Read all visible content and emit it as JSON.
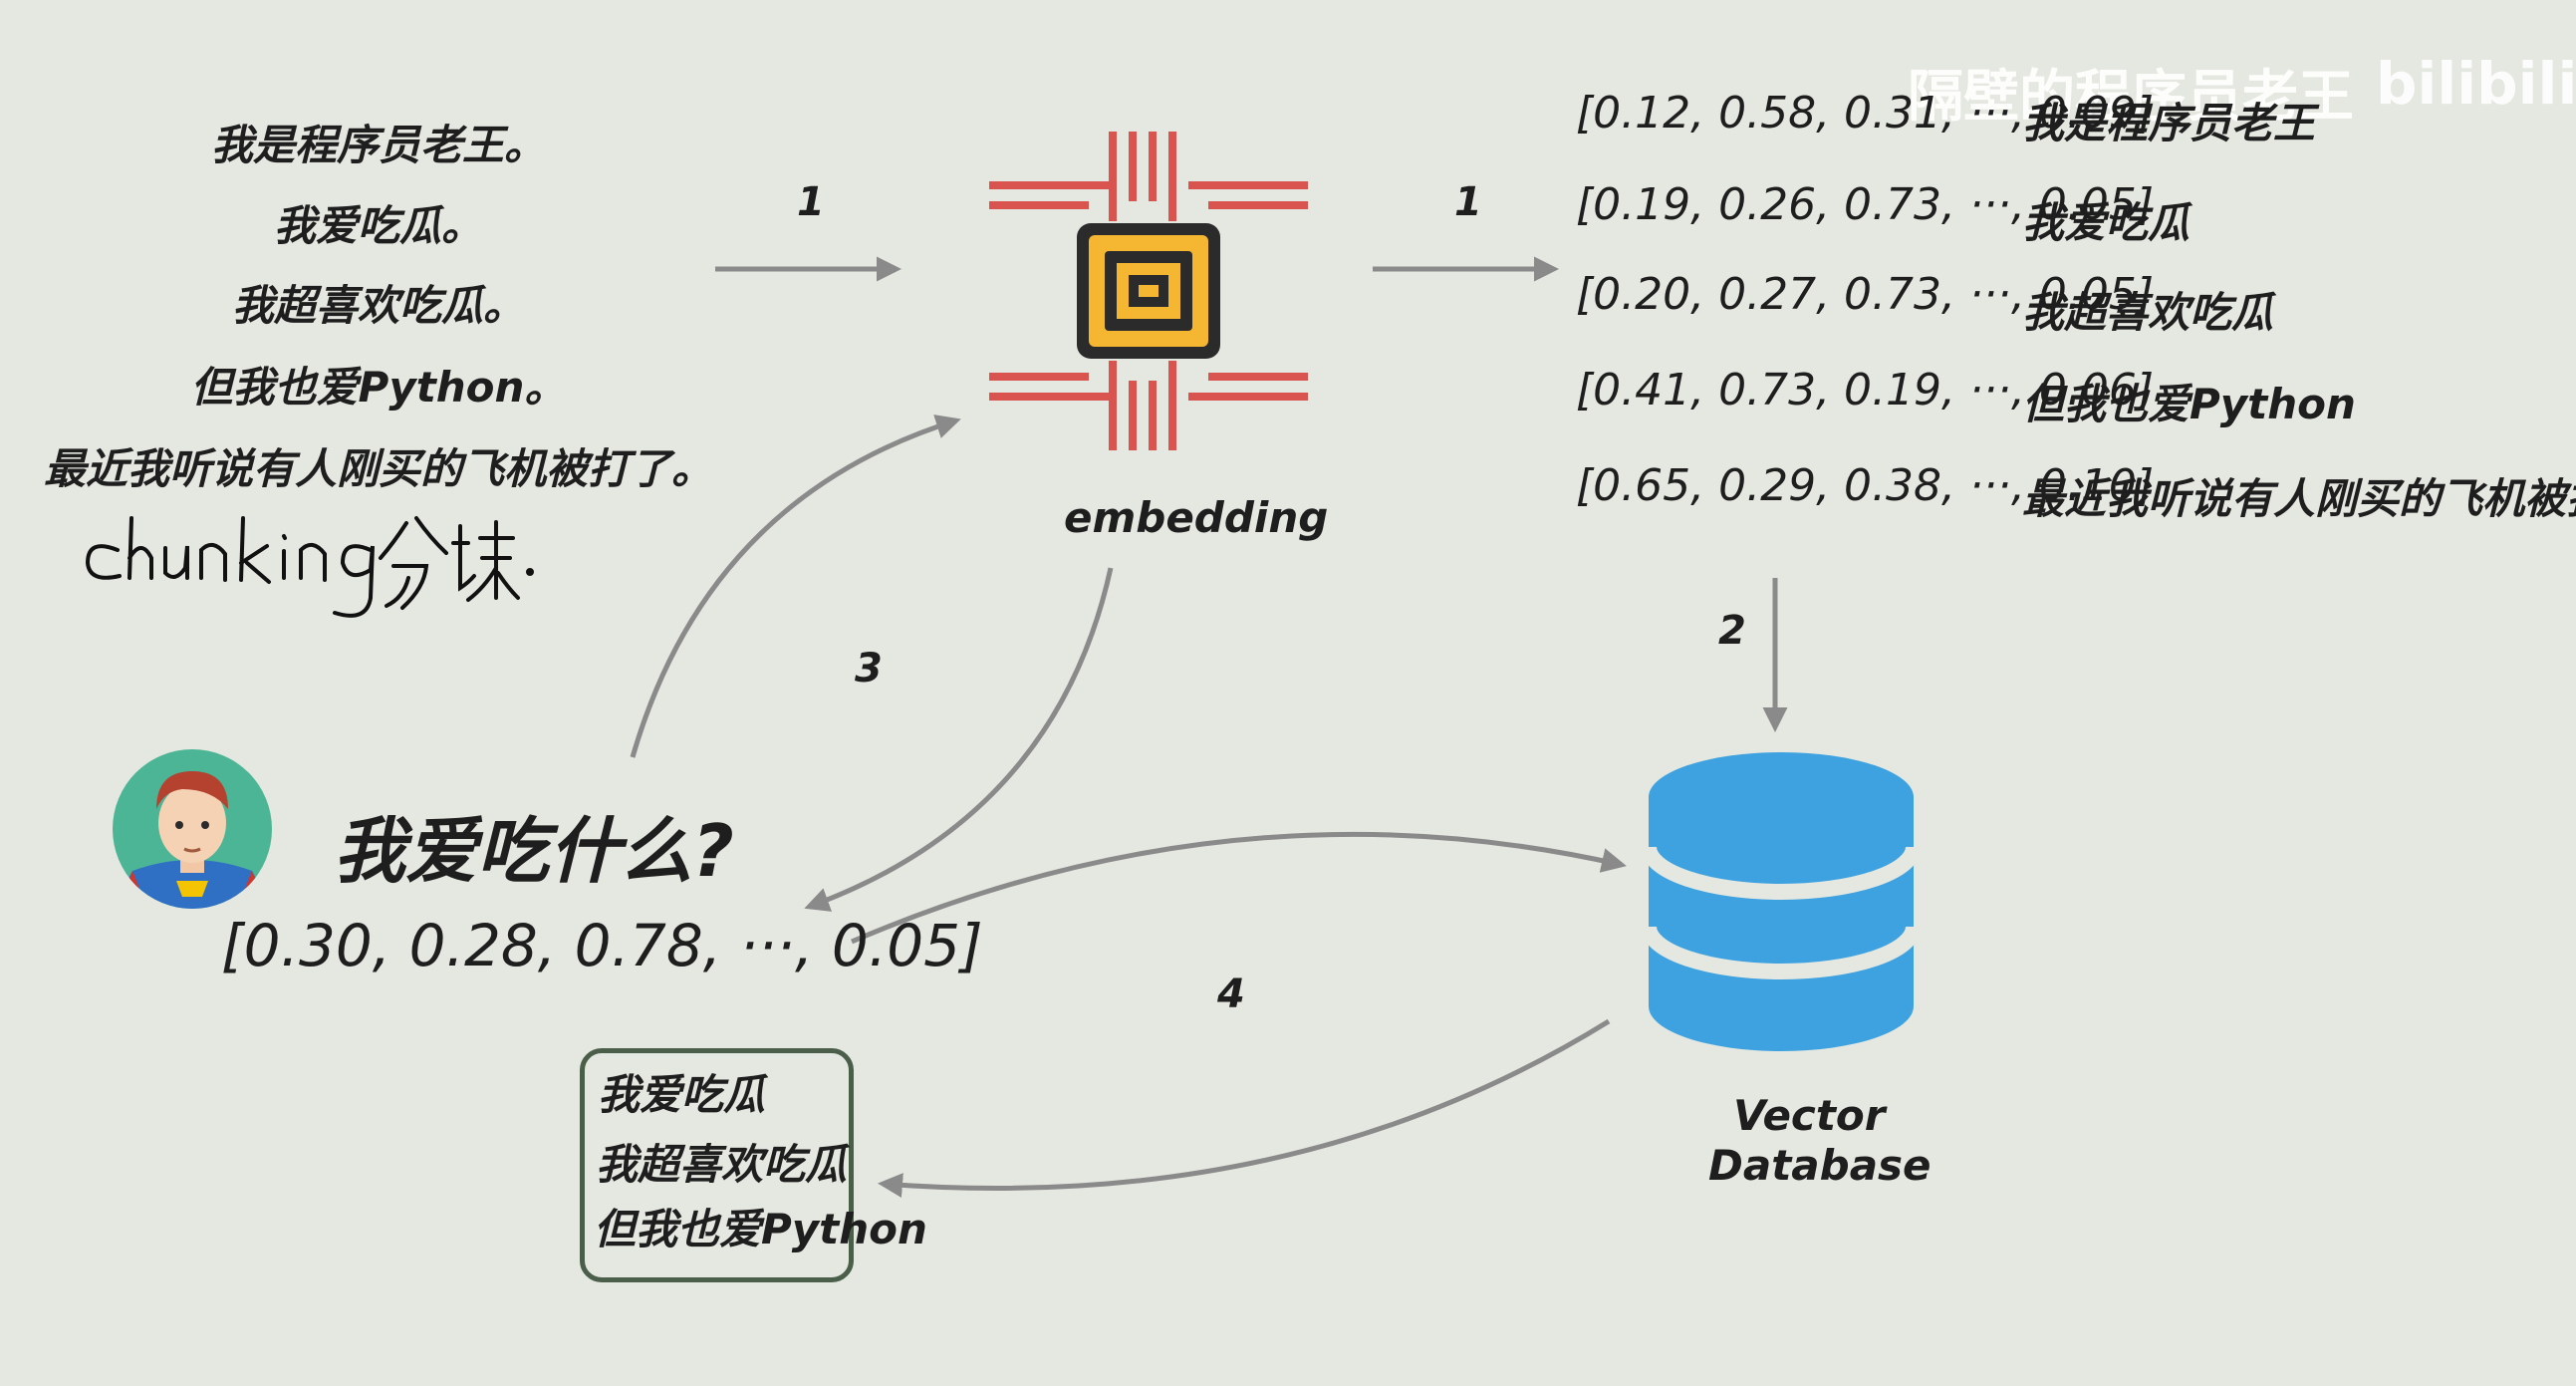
{
  "watermark": {
    "text": "隔壁的程序员老王",
    "logo": "bilibili"
  },
  "chunks": [
    "我是程序员老王。",
    "我爱吃瓜。",
    "我超喜欢吃瓜。",
    "但我也爱Python。",
    "最近我听说有人刚买的飞机被打了。"
  ],
  "handwriting": {
    "text": "chunking 分块."
  },
  "embedding": {
    "label": "embedding",
    "icon": "chip-icon"
  },
  "vectors": [
    {
      "vector": "[0.12, 0.58, 0.31, ···, 0.09]",
      "text": "我是程序员老王"
    },
    {
      "vector": "[0.19, 0.26, 0.73, ···, 0.05]",
      "text": "我爱吃瓜"
    },
    {
      "vector": "[0.20, 0.27, 0.73, ···, 0.05]",
      "text": "我超喜欢吃瓜"
    },
    {
      "vector": "[0.41, 0.73, 0.19, ···, 0.06]",
      "text": "但我也爱Python"
    },
    {
      "vector": "[0.65, 0.29, 0.38, ···, 0.10]",
      "text": "最近我听说有人刚买的飞机被打了"
    }
  ],
  "steps": {
    "a": "1",
    "b": "1",
    "c": "2",
    "d": "3",
    "e": "4"
  },
  "query": {
    "text": "我爱吃什么?",
    "vector": "[0.30, 0.28, 0.78, ···, 0.05]",
    "avatar_icon": "superman-avatar-icon"
  },
  "database": {
    "label_line1": "Vector",
    "label_line2": "Database",
    "icon": "database-icon"
  },
  "results": [
    "我爱吃瓜",
    "我超喜欢吃瓜",
    "但我也爱Python"
  ],
  "colors": {
    "background": "#e4e8e0",
    "arrow": "#8a8a8a",
    "chip_red": "#d9534f",
    "chip_yellow": "#f5b731",
    "database_blue": "#3fa2e0",
    "avatar_green": "#4bb596"
  }
}
